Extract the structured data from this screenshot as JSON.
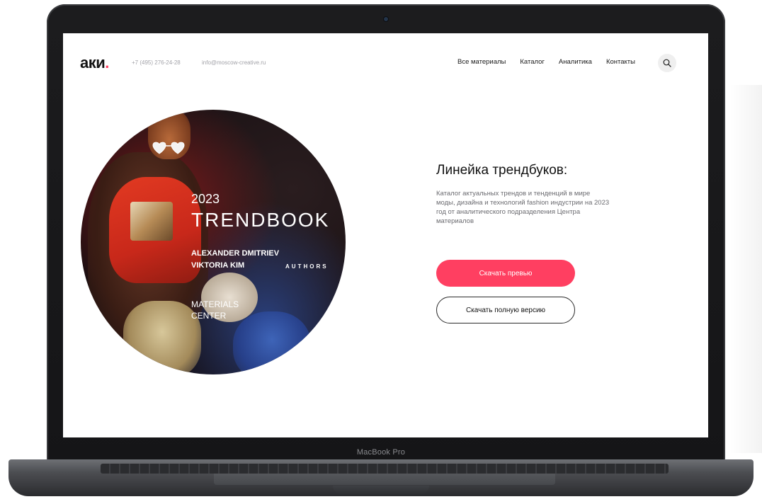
{
  "device": {
    "label": "MacBook Pro"
  },
  "header": {
    "logo_text": "аки",
    "logo_dot": ".",
    "phone": "+7 (495) 276-24-28",
    "email": "info@moscow-creative.ru",
    "nav": [
      {
        "label": "Все материалы"
      },
      {
        "label": "Каталог"
      },
      {
        "label": "Аналитика"
      },
      {
        "label": "Контакты"
      }
    ],
    "search_icon": "search-icon"
  },
  "cover": {
    "year": "2023",
    "title": "TRENDBOOK",
    "author1": "ALEXANDER DMITRIEV",
    "author2": "VIKTORIA KIM",
    "authors_label": "AUTHORS",
    "org1": "MATERIALS",
    "org2": "CENTER"
  },
  "content": {
    "heading": "Линейка трендбуков:",
    "description": "Каталог актуальных трендов и тенденций в мире моды, дизайна и технологий fashion индустрии на 2023 год от аналитического подразделения Центра материалов",
    "primary_button": "Скачать превью",
    "secondary_button": "Скачать полную версию"
  },
  "colors": {
    "accent": "#ff3f61",
    "text": "#111111",
    "muted": "#a2a2a8"
  }
}
